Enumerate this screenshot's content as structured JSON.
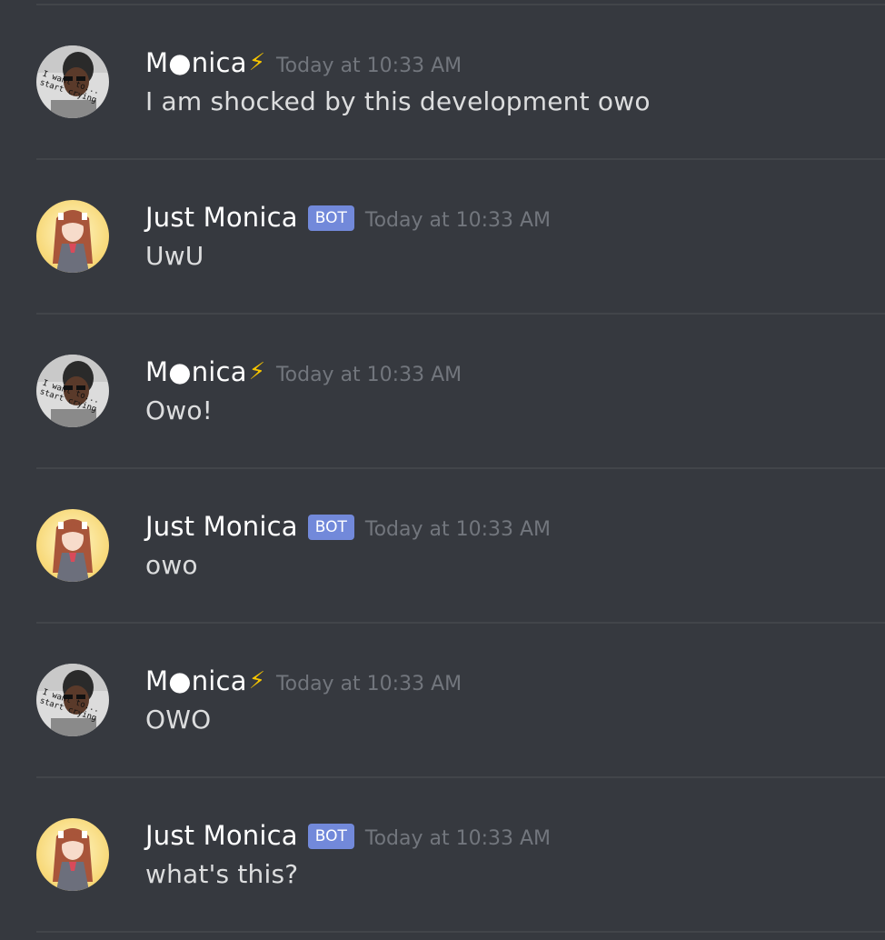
{
  "messages": [
    {
      "author": "M●nica",
      "bolt": "⚡",
      "is_bot": false,
      "bot_tag": "",
      "avatar": "human-avatar",
      "timestamp": "Today at 10:33 AM",
      "text": "I am shocked by this development owo"
    },
    {
      "author": "Just Monica",
      "bolt": "",
      "is_bot": true,
      "bot_tag": "BOT",
      "avatar": "anime-avatar",
      "timestamp": "Today at 10:33 AM",
      "text": "UwU"
    },
    {
      "author": "M●nica",
      "bolt": "⚡",
      "is_bot": false,
      "bot_tag": "",
      "avatar": "human-avatar",
      "timestamp": "Today at 10:33 AM",
      "text": "Owo!"
    },
    {
      "author": "Just Monica",
      "bolt": "",
      "is_bot": true,
      "bot_tag": "BOT",
      "avatar": "anime-avatar",
      "timestamp": "Today at 10:33 AM",
      "text": "owo"
    },
    {
      "author": "M●nica",
      "bolt": "⚡",
      "is_bot": false,
      "bot_tag": "",
      "avatar": "human-avatar",
      "timestamp": "Today at 10:33 AM",
      "text": "OWO"
    },
    {
      "author": "Just Monica",
      "bolt": "",
      "is_bot": true,
      "bot_tag": "BOT",
      "avatar": "anime-avatar",
      "timestamp": "Today at 10:33 AM",
      "text": "what's this?"
    }
  ],
  "colors": {
    "background": "#36393f",
    "divider": "#42454a",
    "username": "#ffffff",
    "timestamp": "#72767d",
    "message_text": "#dcddde",
    "bot_tag": "#7289da",
    "bolt": "#f5c400"
  }
}
